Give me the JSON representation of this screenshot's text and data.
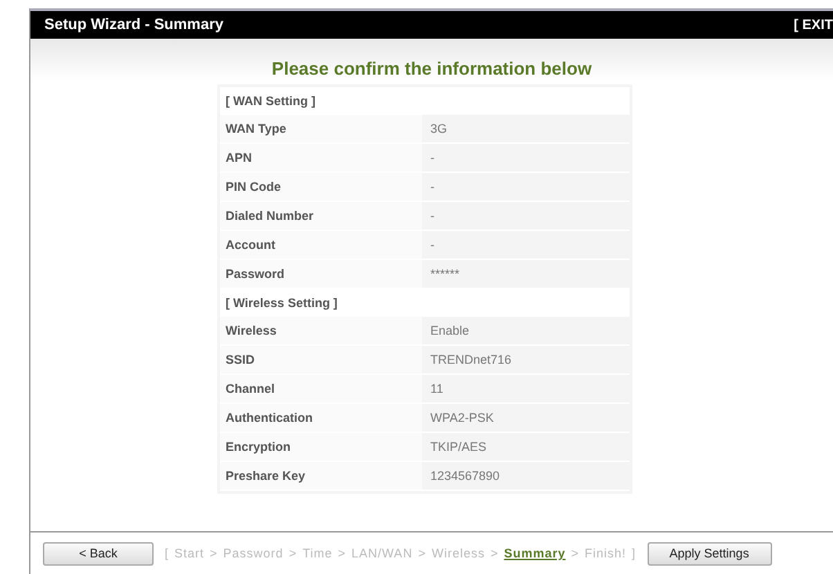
{
  "window": {
    "title": "Setup Wizard - Summary",
    "exit": "[ EXIT"
  },
  "heading": "Please confirm the information below",
  "sections": [
    {
      "title": "[ WAN Setting ]",
      "rows": [
        {
          "label": "WAN Type",
          "value": "3G"
        },
        {
          "label": "APN",
          "value": "-"
        },
        {
          "label": "PIN Code",
          "value": "-"
        },
        {
          "label": "Dialed Number",
          "value": "-"
        },
        {
          "label": "Account",
          "value": "-"
        },
        {
          "label": "Password",
          "value": "******"
        }
      ]
    },
    {
      "title": "[ Wireless Setting ]",
      "rows": [
        {
          "label": "Wireless",
          "value": "Enable"
        },
        {
          "label": "SSID",
          "value": "TRENDnet716"
        },
        {
          "label": "Channel",
          "value": "11"
        },
        {
          "label": "Authentication",
          "value": "WPA2-PSK"
        },
        {
          "label": "Encryption",
          "value": "TKIP/AES"
        },
        {
          "label": "Preshare Key",
          "value": "1234567890"
        }
      ]
    }
  ],
  "footer": {
    "back": "< Back",
    "apply": "Apply Settings",
    "open": "[",
    "close": "]",
    "separator": ">",
    "steps": [
      {
        "label": "Start",
        "selected": false
      },
      {
        "label": "Password",
        "selected": false
      },
      {
        "label": "Time",
        "selected": false
      },
      {
        "label": "LAN/WAN",
        "selected": false
      },
      {
        "label": "Wireless",
        "selected": false
      },
      {
        "label": "Summary",
        "selected": true
      },
      {
        "label": "Finish!",
        "selected": false
      }
    ]
  }
}
